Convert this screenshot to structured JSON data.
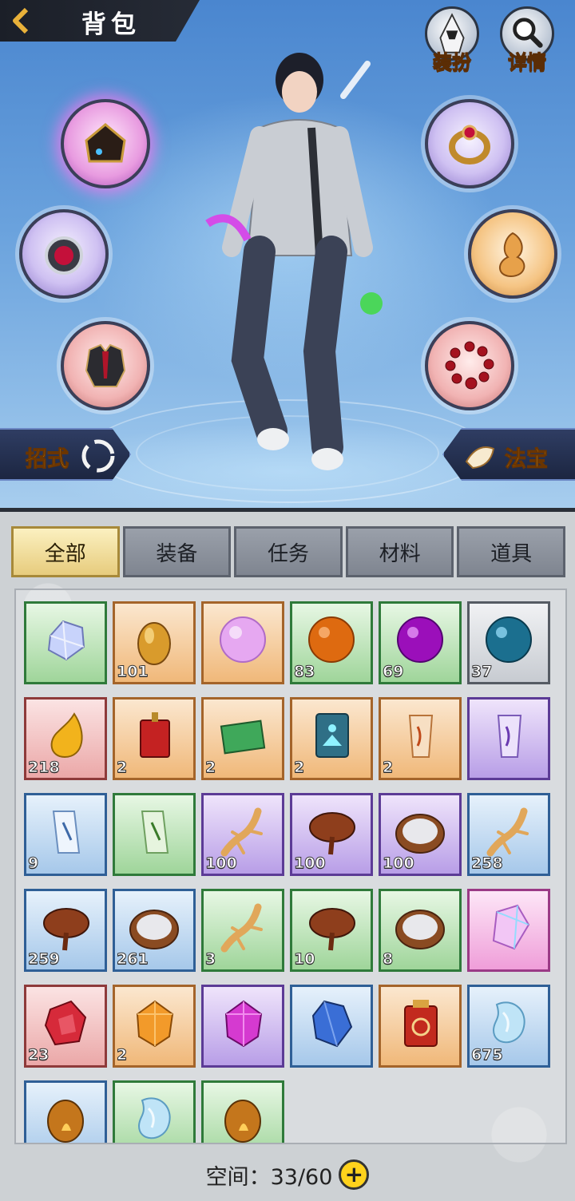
{
  "header": {
    "title": "背包",
    "back_icon": "chevron-left-icon"
  },
  "top_buttons": [
    {
      "label": "装扮",
      "icon": "hooded-figure-icon"
    },
    {
      "label": "详情",
      "icon": "magnifier-icon"
    }
  ],
  "equipment_slots": [
    {
      "icon": "hat-icon",
      "side": "left"
    },
    {
      "icon": "amulet-icon",
      "side": "left"
    },
    {
      "icon": "armor-icon",
      "side": "left"
    },
    {
      "icon": "ring-icon",
      "side": "right"
    },
    {
      "icon": "gourd-icon",
      "side": "right"
    },
    {
      "icon": "bead-bracelet-icon",
      "side": "right"
    }
  ],
  "skills_button": {
    "label": "招式"
  },
  "treasure_button": {
    "label": "法宝"
  },
  "tabs": [
    "全部",
    "装备",
    "任务",
    "材料",
    "道具"
  ],
  "active_tab": "全部",
  "items": [
    {
      "rarity": "green",
      "icon": "crystal-icon",
      "count": ""
    },
    {
      "rarity": "orange",
      "icon": "gold-stone-icon",
      "count": "101"
    },
    {
      "rarity": "orange",
      "icon": "pink-orb-icon",
      "count": ""
    },
    {
      "rarity": "green",
      "icon": "orange-orb-icon",
      "count": "83"
    },
    {
      "rarity": "green",
      "icon": "purple-orb-icon",
      "count": "69"
    },
    {
      "rarity": "gray",
      "icon": "blue-orb-icon",
      "count": "37"
    },
    {
      "rarity": "red",
      "icon": "golden-drop-icon",
      "count": "218"
    },
    {
      "rarity": "orange",
      "icon": "red-tag-icon",
      "count": "2"
    },
    {
      "rarity": "orange",
      "icon": "jade-book-icon",
      "count": "2"
    },
    {
      "rarity": "orange",
      "icon": "meditation-card-icon",
      "count": "2"
    },
    {
      "rarity": "orange",
      "icon": "scroll-orange-icon",
      "count": "2"
    },
    {
      "rarity": "purple",
      "icon": "scroll-purple-icon",
      "count": ""
    },
    {
      "rarity": "blue",
      "icon": "scroll-blue-icon",
      "count": "9"
    },
    {
      "rarity": "green",
      "icon": "scroll-green-icon",
      "count": ""
    },
    {
      "rarity": "purple",
      "icon": "ginseng-icon",
      "count": "100"
    },
    {
      "rarity": "purple",
      "icon": "lingzhi-icon",
      "count": "100"
    },
    {
      "rarity": "purple",
      "icon": "rice-bowl-icon",
      "count": "100"
    },
    {
      "rarity": "blue",
      "icon": "ginseng-icon",
      "count": "258"
    },
    {
      "rarity": "blue",
      "icon": "lingzhi-icon",
      "count": "259"
    },
    {
      "rarity": "blue",
      "icon": "rice-bowl-icon",
      "count": "261"
    },
    {
      "rarity": "green",
      "icon": "ginseng-icon",
      "count": "3"
    },
    {
      "rarity": "green",
      "icon": "lingzhi-icon",
      "count": "10"
    },
    {
      "rarity": "green",
      "icon": "rice-bowl-icon",
      "count": "8"
    },
    {
      "rarity": "pink",
      "icon": "prism-gem-icon",
      "count": ""
    },
    {
      "rarity": "red",
      "icon": "red-gem-icon",
      "count": "23"
    },
    {
      "rarity": "orange",
      "icon": "amber-gem-icon",
      "count": "2"
    },
    {
      "rarity": "purple",
      "icon": "magenta-gem-icon",
      "count": ""
    },
    {
      "rarity": "blue",
      "icon": "blue-gem-icon",
      "count": ""
    },
    {
      "rarity": "orange",
      "icon": "command-token-icon",
      "count": ""
    },
    {
      "rarity": "blue",
      "icon": "ice-stone-icon",
      "count": "675"
    },
    {
      "rarity": "blue",
      "icon": "fire-stone-icon",
      "count": ""
    },
    {
      "rarity": "green",
      "icon": "ice-stone-icon",
      "count": ""
    },
    {
      "rarity": "green",
      "icon": "fire-stone-icon",
      "count": ""
    }
  ],
  "footer": {
    "space_label": "空间：33/60",
    "expand_icon": "plus-icon"
  },
  "colors": {
    "accent": "#ffd34a",
    "title_bar": "#1b1f28",
    "panel": "#cdd1d4"
  }
}
